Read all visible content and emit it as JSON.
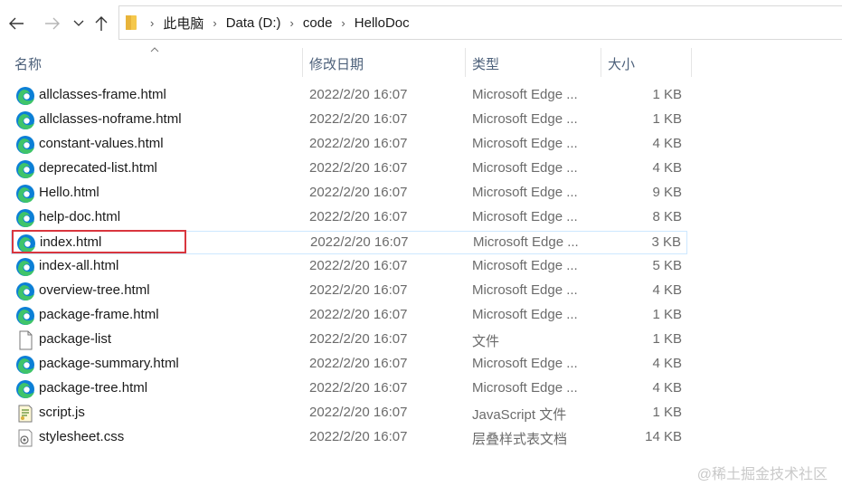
{
  "breadcrumb": [
    "此电脑",
    "Data (D:)",
    "code",
    "HelloDoc"
  ],
  "columns": {
    "name": "名称",
    "date": "修改日期",
    "type": "类型",
    "size": "大小"
  },
  "files": [
    {
      "name": "allclasses-frame.html",
      "date": "2022/2/20 16:07",
      "type": "Microsoft Edge ...",
      "size": "1 KB",
      "icon": "edge-icon"
    },
    {
      "name": "allclasses-noframe.html",
      "date": "2022/2/20 16:07",
      "type": "Microsoft Edge ...",
      "size": "1 KB",
      "icon": "edge-icon"
    },
    {
      "name": "constant-values.html",
      "date": "2022/2/20 16:07",
      "type": "Microsoft Edge ...",
      "size": "4 KB",
      "icon": "edge-icon"
    },
    {
      "name": "deprecated-list.html",
      "date": "2022/2/20 16:07",
      "type": "Microsoft Edge ...",
      "size": "4 KB",
      "icon": "edge-icon"
    },
    {
      "name": "Hello.html",
      "date": "2022/2/20 16:07",
      "type": "Microsoft Edge ...",
      "size": "9 KB",
      "icon": "edge-icon"
    },
    {
      "name": "help-doc.html",
      "date": "2022/2/20 16:07",
      "type": "Microsoft Edge ...",
      "size": "8 KB",
      "icon": "edge-icon"
    },
    {
      "name": "index.html",
      "date": "2022/2/20 16:07",
      "type": "Microsoft Edge ...",
      "size": "3 KB",
      "icon": "edge-icon"
    },
    {
      "name": "index-all.html",
      "date": "2022/2/20 16:07",
      "type": "Microsoft Edge ...",
      "size": "5 KB",
      "icon": "edge-icon"
    },
    {
      "name": "overview-tree.html",
      "date": "2022/2/20 16:07",
      "type": "Microsoft Edge ...",
      "size": "4 KB",
      "icon": "edge-icon"
    },
    {
      "name": "package-frame.html",
      "date": "2022/2/20 16:07",
      "type": "Microsoft Edge ...",
      "size": "1 KB",
      "icon": "edge-icon"
    },
    {
      "name": "package-list",
      "date": "2022/2/20 16:07",
      "type": "文件",
      "size": "1 KB",
      "icon": "blank-file-icon"
    },
    {
      "name": "package-summary.html",
      "date": "2022/2/20 16:07",
      "type": "Microsoft Edge ...",
      "size": "4 KB",
      "icon": "edge-icon"
    },
    {
      "name": "package-tree.html",
      "date": "2022/2/20 16:07",
      "type": "Microsoft Edge ...",
      "size": "4 KB",
      "icon": "edge-icon"
    },
    {
      "name": "script.js",
      "date": "2022/2/20 16:07",
      "type": "JavaScript 文件",
      "size": "1 KB",
      "icon": "script-file-icon"
    },
    {
      "name": "stylesheet.css",
      "date": "2022/2/20 16:07",
      "type": "层叠样式表文档",
      "size": "14 KB",
      "icon": "css-file-icon"
    }
  ],
  "selected_file": "index.html",
  "watermark": "@稀土掘金技术社区",
  "colors": {
    "edge_blue": "#0c7fd6",
    "edge_green": "#3fc46a",
    "highlight_red": "#d9363e"
  }
}
